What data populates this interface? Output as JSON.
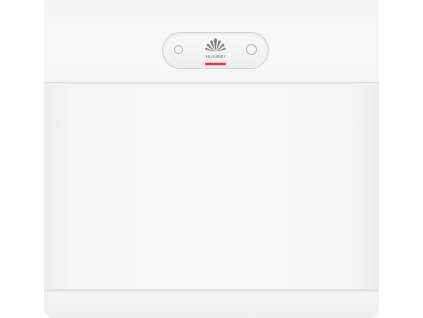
{
  "brand": {
    "name": "HUAWEI",
    "logo_icon": "huawei-logo-icon"
  },
  "device": {
    "color": "#f6f6f7",
    "indicator_color": "#e8382c"
  }
}
